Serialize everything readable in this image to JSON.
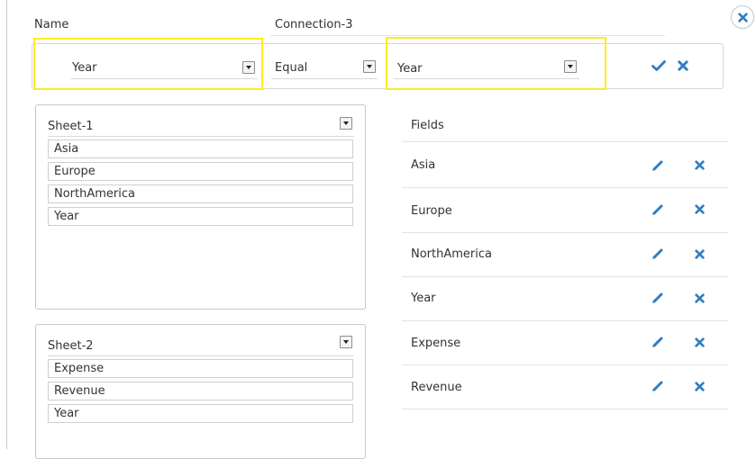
{
  "dialog": {
    "name_label": "Name",
    "name_value": "Connection-3"
  },
  "condition": {
    "left_field": "Year",
    "operator": "Equal",
    "right_field": "Year",
    "confirm_icon": "check-icon",
    "remove_icon": "close-icon"
  },
  "sheets": [
    {
      "title": "Sheet-1",
      "fields": [
        "Asia",
        "Europe",
        "NorthAmerica",
        "Year"
      ]
    },
    {
      "title": "Sheet-2",
      "fields": [
        "Expense",
        "Revenue",
        "Year"
      ]
    }
  ],
  "fields_panel": {
    "header": "Fields",
    "items": [
      "Asia",
      "Europe",
      "NorthAmerica",
      "Year",
      "Expense",
      "Revenue"
    ],
    "edit_icon": "pencil-icon",
    "delete_icon": "close-icon"
  },
  "colors": {
    "accent_blue": "#2f7ec1",
    "highlight_yellow": "#ffec20"
  }
}
